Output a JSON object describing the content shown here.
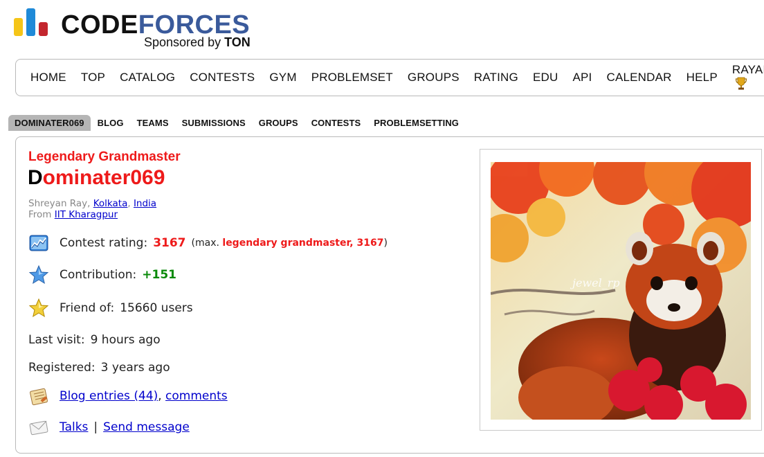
{
  "logo": {
    "word_code": "CODE",
    "word_forces": "FORCES",
    "sponsored_prefix": "Sponsored by",
    "sponsor": "TON",
    "colors": {
      "bar_yellow": "#f5c518",
      "bar_blue": "#1f8ad8",
      "bar_red": "#c3262e",
      "forces_blue": "#3a5a9b"
    }
  },
  "main_menu": {
    "items": [
      "HOME",
      "TOP",
      "CATALOG",
      "CONTESTS",
      "GYM",
      "PROBLEMSET",
      "GROUPS",
      "RATING",
      "EDU",
      "API",
      "CALENDAR",
      "HELP",
      "RAYAN"
    ],
    "trophy_icon": "trophy-icon"
  },
  "second_menu": {
    "items": [
      "DOMINATER069",
      "BLOG",
      "TEAMS",
      "SUBMISSIONS",
      "GROUPS",
      "CONTESTS",
      "PROBLEMSETTING"
    ],
    "active": "DOMINATER069"
  },
  "profile": {
    "rank": "Legendary Grandmaster",
    "handle_first": "D",
    "handle_rest": "ominater069",
    "name": "Shreyan Ray",
    "city": "Kolkata",
    "country": "India",
    "from_label": "From",
    "organization": "IIT Kharagpur",
    "rating": {
      "label": "Contest rating:",
      "value": "3167",
      "max_prefix": "(max.",
      "max_text": "legendary grandmaster, 3167",
      "max_suffix": ")"
    },
    "contribution": {
      "label": "Contribution:",
      "value": "+151"
    },
    "friends": {
      "label": "Friend of:",
      "value": "15660 users"
    },
    "last_visit": {
      "label": "Last visit:",
      "value": "9 hours ago"
    },
    "registered": {
      "label": "Registered:",
      "value": "3 years ago"
    },
    "blog": {
      "entries": "Blog entries (44)",
      "comments": "comments"
    },
    "talks": {
      "talks": "Talks",
      "sep": "|",
      "send": "Send message"
    },
    "colors": {
      "legendary_red": "#ee1a1a",
      "contribution_green": "#0a8a0a"
    }
  },
  "avatar": {
    "watermark": "jewel_rp"
  }
}
